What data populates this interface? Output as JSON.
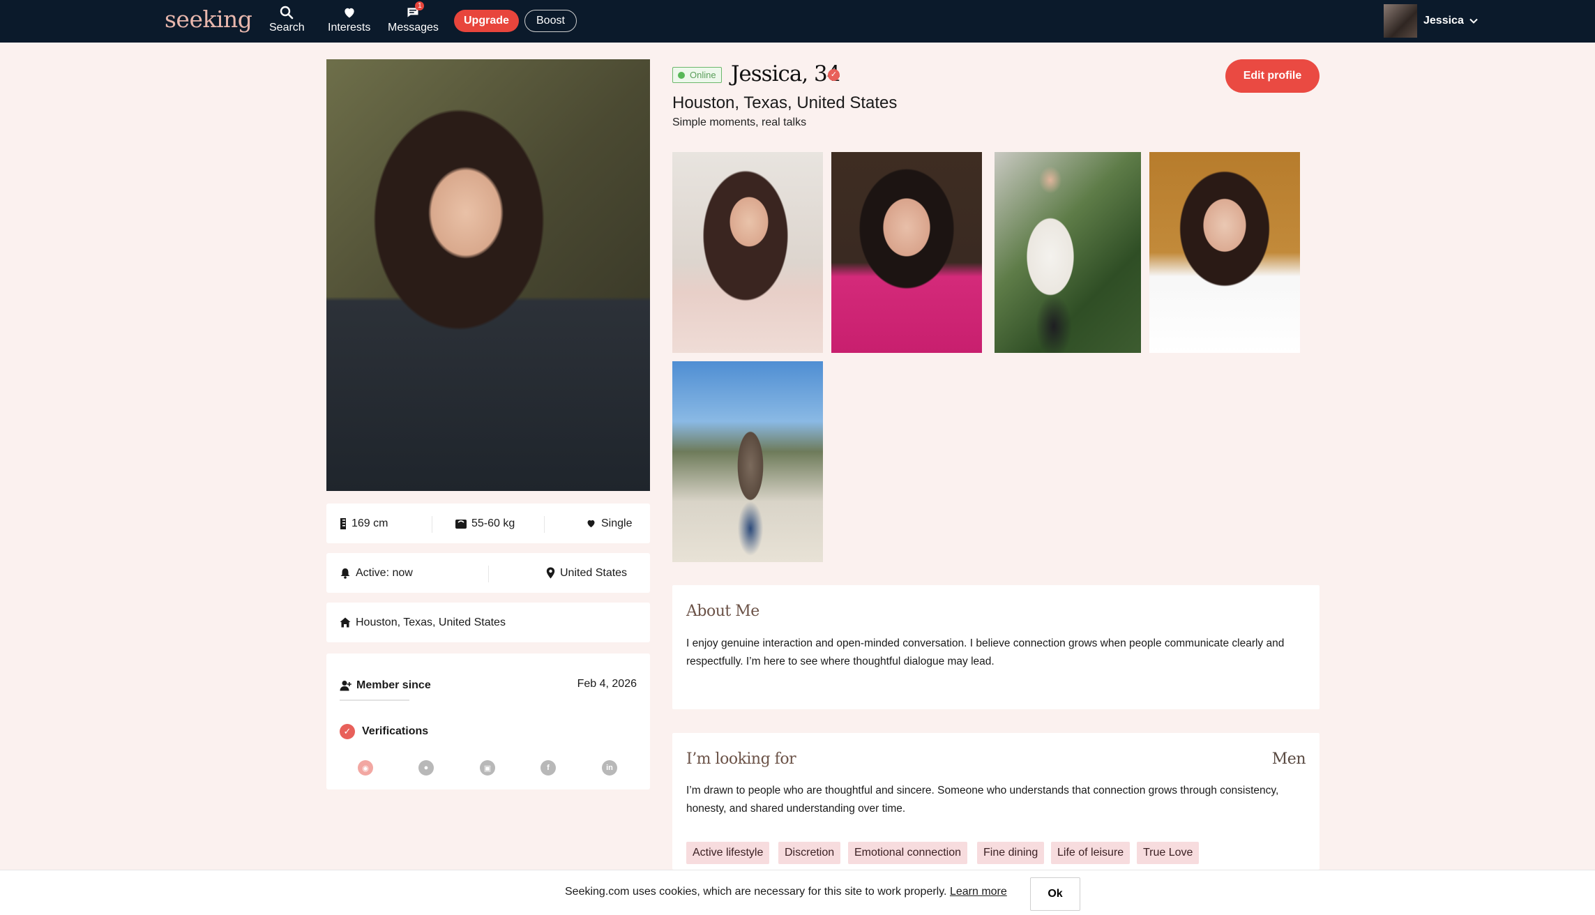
{
  "nav": {
    "logo": "seeking",
    "items": [
      {
        "label": "Search",
        "icon": "search-icon"
      },
      {
        "label": "Interests",
        "icon": "heart-icon"
      },
      {
        "label": "Messages",
        "icon": "message-icon",
        "badge": "1"
      }
    ],
    "upgrade_label": "Upgrade",
    "boost_label": "Boost",
    "user_name": "Jessica"
  },
  "profile": {
    "online_label": "Online",
    "name_age": "Jessica, 34",
    "location": "Houston, Texas, United States",
    "tagline": "Simple moments, real talks",
    "edit_label": "Edit profile"
  },
  "stats": {
    "height": "169 cm",
    "weight": "55-60 kg",
    "relationship": "Single",
    "active": "Active: now",
    "country": "United States",
    "home": "Houston, Texas, United States"
  },
  "membership": {
    "member_since_label": "Member since",
    "member_since_value": "Feb 4, 2026",
    "verifications_label": "Verifications",
    "verification_icons": [
      "photo-verify-icon",
      "profile-verify-icon",
      "id-verify-icon",
      "facebook-icon",
      "linkedin-icon"
    ]
  },
  "about": {
    "title": "About Me",
    "body": "I enjoy genuine interaction and open-minded conversation. I believe connection grows when people communicate clearly and respectfully. I’m here to see where thoughtful dialogue may lead."
  },
  "looking": {
    "title": "I’m looking for",
    "gender": "Men",
    "body": "I’m drawn to people who are thoughtful and sincere. Someone who understands that connection grows through consistency, honesty, and shared understanding over time.",
    "tags": [
      "Active lifestyle",
      "Discretion",
      "Emotional connection",
      "Fine dining",
      "Life of leisure",
      "True Love"
    ]
  },
  "cookie": {
    "text": "Seeking.com uses cookies, which are necessary for this site to work properly.",
    "link": "Learn more",
    "ok_label": "Ok"
  },
  "colors": {
    "nav_bg": "#0b1a2b",
    "accent": "#e8453c",
    "page_bg": "#fbf1ef",
    "tag_bg": "#f7dcde"
  }
}
